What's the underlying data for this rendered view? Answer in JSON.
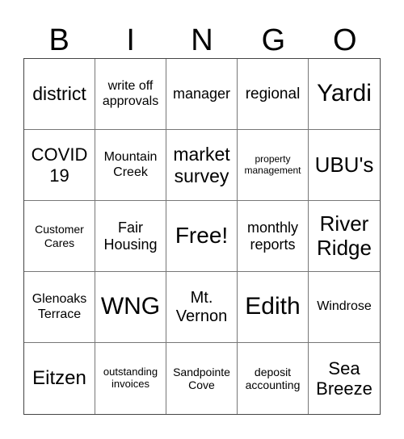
{
  "header": [
    "B",
    "I",
    "N",
    "G",
    "O"
  ],
  "cells": [
    "district",
    "write off approvals",
    "manager",
    "regional",
    "Yardi",
    "COVID 19",
    "Mountain Creek",
    "market survey",
    "property management",
    "UBU's",
    "Customer Cares",
    "Fair Housing",
    "Free!",
    "monthly reports",
    "River Ridge",
    "Glenoaks Terrace",
    "WNG",
    "Mt. Vernon",
    "Edith",
    "Windrose",
    "Eitzen",
    "outstanding invoices",
    "Sandpointe Cove",
    "deposit accounting",
    "Sea Breeze"
  ]
}
